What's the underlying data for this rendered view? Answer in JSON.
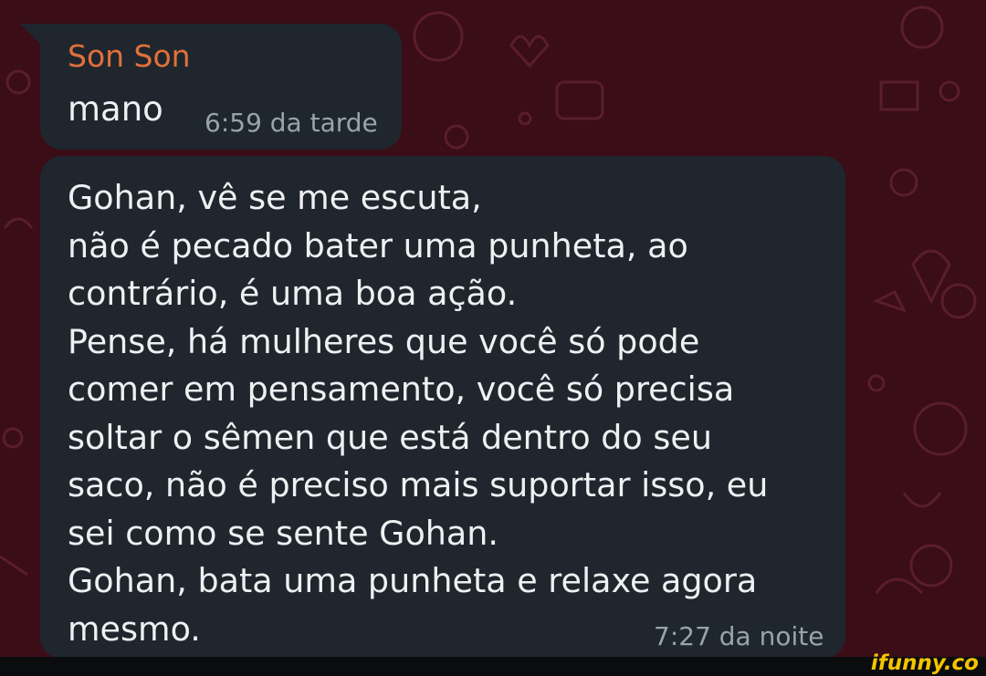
{
  "chat": {
    "message1": {
      "sender": "Son Son",
      "text": "mano",
      "time": "6:59 da tarde"
    },
    "message2": {
      "text": "Gohan, vê se me escuta,\nnão é pecado bater uma punheta, ao\ncontrário, é uma boa ação.\nPense, há mulheres que você só pode\ncomer em pensamento, você só precisa\nsoltar o sêmen que está dentro do seu\nsaco, não é preciso mais suportar isso, eu\nsei como se sente Gohan.\nGohan, bata uma punheta e relaxe agora\nmesmo.",
      "time": "7:27 da noite"
    }
  },
  "watermark": "ifunny.co",
  "colors": {
    "background": "#3a0d17",
    "bubble": "#1f262d",
    "sender_name": "#e2703a",
    "timestamp": "#9aa3ab",
    "watermark": "#f5c400"
  }
}
